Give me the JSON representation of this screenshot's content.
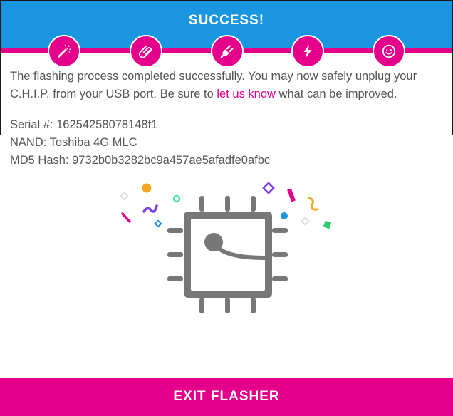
{
  "header": {
    "title": "SUCCESS!"
  },
  "steps": [
    {
      "icon": "magic-wand-icon"
    },
    {
      "icon": "paperclip-icon"
    },
    {
      "icon": "plug-icon"
    },
    {
      "icon": "lightning-bolt-icon"
    },
    {
      "icon": "smiley-icon"
    }
  ],
  "message": {
    "text_before": "The flashing process completed successfully. You may now safely unplug your C.H.I.P. from your USB port.  Be sure to ",
    "link_text": "let us know",
    "text_after": " what can be improved."
  },
  "device_info": {
    "serial": "Serial #: 16254258078148f1",
    "nand": "NAND: Toshiba 4G MLC",
    "md5": "MD5 Hash: 9732b0b3282bc9a457ae5afadfe0afbc"
  },
  "footer": {
    "button_label": "EXIT FLASHER"
  },
  "colors": {
    "header": "#1a96e0",
    "accent": "#e5008c",
    "text": "#555555",
    "chip": "#777777"
  }
}
